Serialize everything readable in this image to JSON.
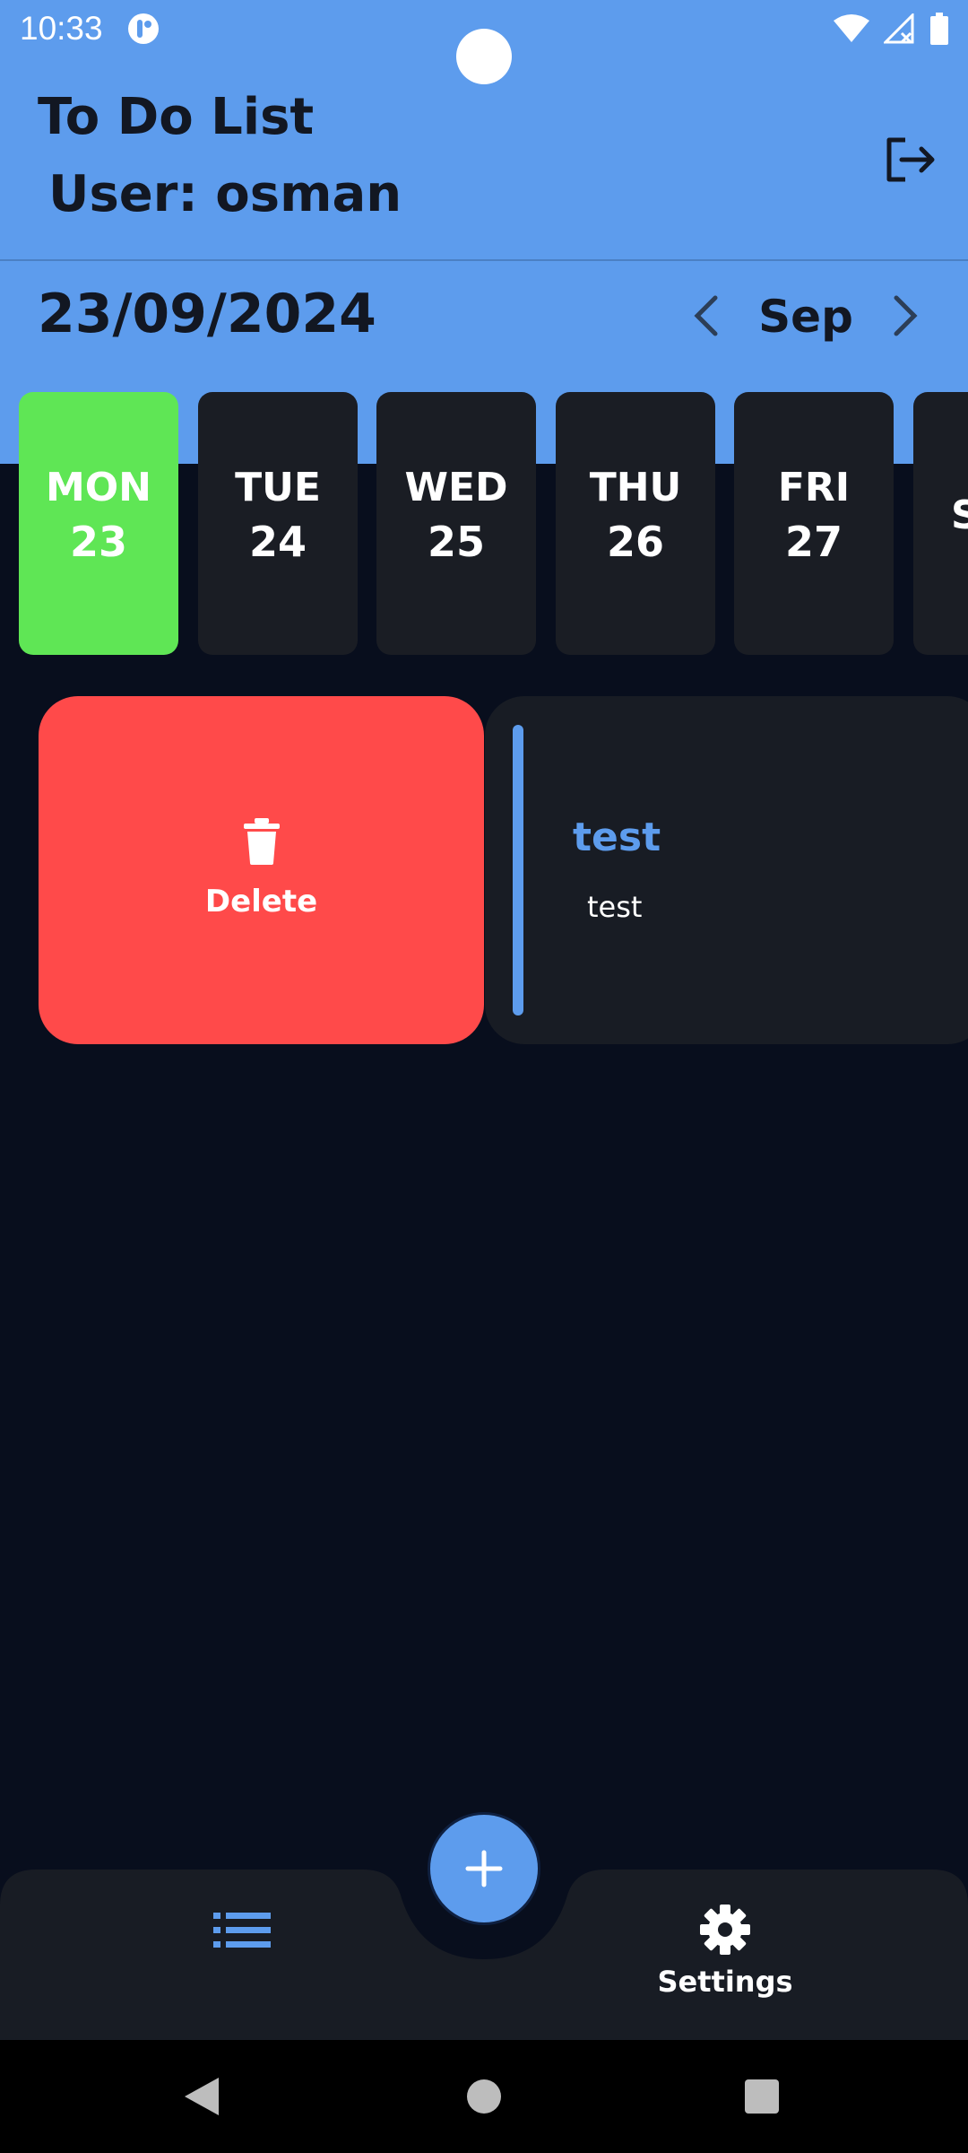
{
  "status_bar": {
    "time": "10:33"
  },
  "header": {
    "title": "To Do List",
    "user": "User: osman",
    "date": "23/09/2024",
    "month": "Sep"
  },
  "days": [
    {
      "dow": "MON",
      "num": "23",
      "active": true
    },
    {
      "dow": "TUE",
      "num": "24",
      "active": false
    },
    {
      "dow": "WED",
      "num": "25",
      "active": false
    },
    {
      "dow": "THU",
      "num": "26",
      "active": false
    },
    {
      "dow": "FRI",
      "num": "27",
      "active": false
    },
    {
      "dow": "S",
      "num": "",
      "active": false
    }
  ],
  "task": {
    "delete_label": "Delete",
    "title": "test",
    "description": "test"
  },
  "bottom_nav": {
    "settings_label": "Settings"
  },
  "colors": {
    "header_bg": "#5d9ced",
    "active_day": "#5fe655",
    "delete_bg": "#ff4a4a",
    "page_bg": "#080e1d",
    "card_bg": "#181c24"
  }
}
